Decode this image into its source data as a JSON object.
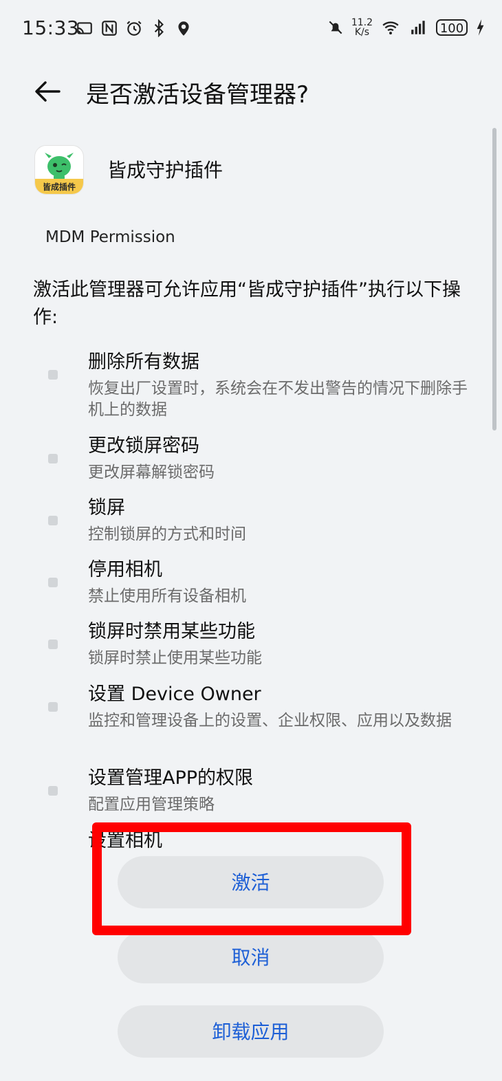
{
  "status_bar": {
    "time": "15:33",
    "net_speed_value": "11.2",
    "net_speed_unit": "K/s",
    "battery": "100"
  },
  "header": {
    "title": "是否激活设备管理器?"
  },
  "app": {
    "name": "皆成守护插件",
    "icon_label": "皆成插件",
    "subtitle": "MDM Permission"
  },
  "description": "激活此管理器可允许应用“皆成守护插件”执行以下操作:",
  "permissions": [
    {
      "title": "删除所有数据",
      "desc": "恢复出厂设置时，系统会在不发出警告的情况下删除手机上的数据"
    },
    {
      "title": "更改锁屏密码",
      "desc": "更改屏幕解锁密码"
    },
    {
      "title": "锁屏",
      "desc": "控制锁屏的方式和时间"
    },
    {
      "title": "停用相机",
      "desc": "禁止使用所有设备相机"
    },
    {
      "title": "锁屏时禁用某些功能",
      "desc": "锁屏时禁止使用某些功能"
    },
    {
      "title": "设置 Device Owner",
      "desc": "监控和管理设备上的设置、企业权限、应用以及数据"
    },
    {
      "title": "设置管理APP的权限",
      "desc": "配置应用管理策略"
    }
  ],
  "partial_item": "设置相机",
  "buttons": {
    "activate": "激活",
    "cancel": "取消",
    "uninstall": "卸载应用"
  },
  "colors": {
    "accent": "#1d5fd6",
    "highlight": "#ff0000",
    "background": "#f1f3f5",
    "button_bg": "#e3e5e7"
  },
  "icons": [
    "nfc-icon",
    "cast-icon",
    "alarm-icon",
    "bluetooth-icon",
    "location-icon",
    "mute-icon",
    "wifi-icon",
    "signal-icon",
    "battery-icon",
    "charging-icon",
    "back-arrow-icon"
  ]
}
